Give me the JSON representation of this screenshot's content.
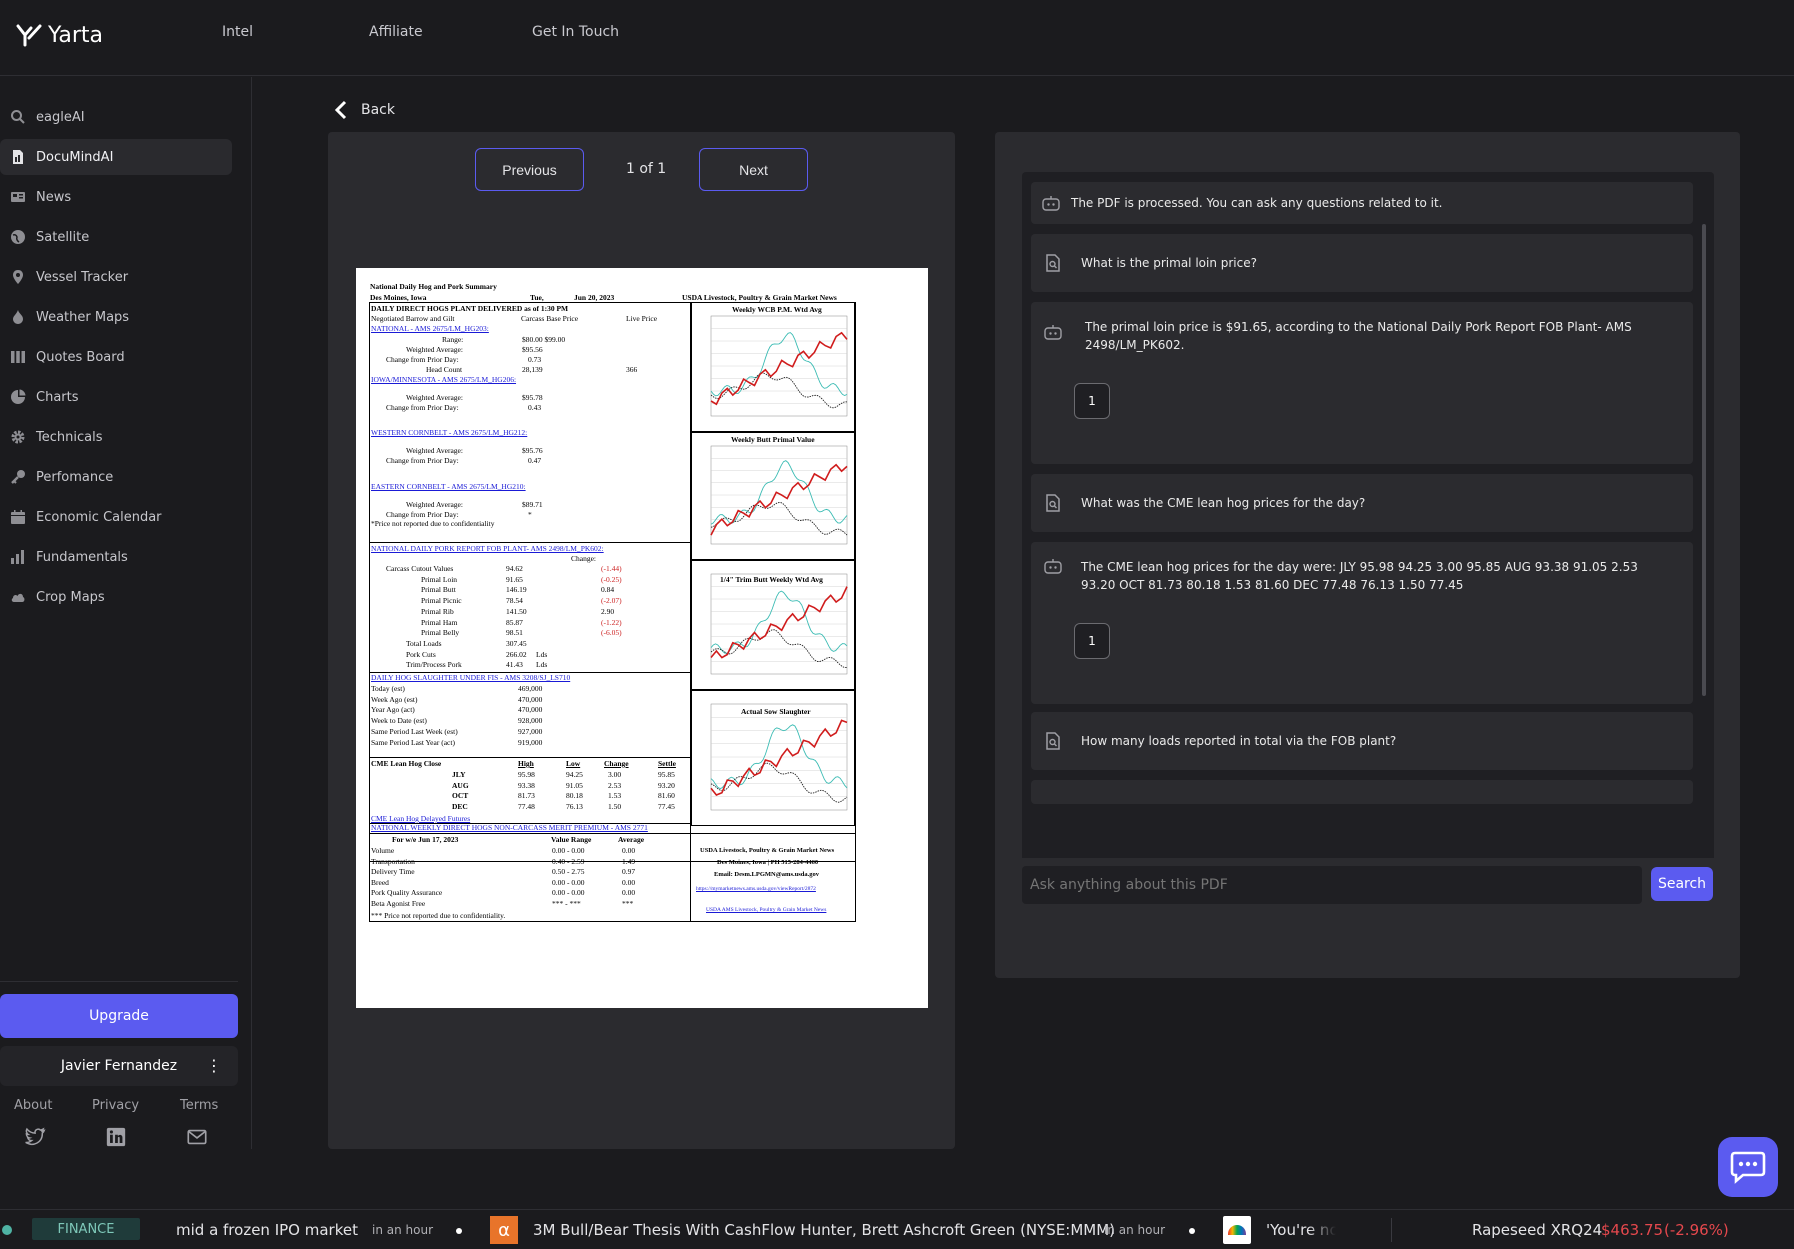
{
  "app": {
    "name": "Yarta"
  },
  "topnav": {
    "items": [
      "Intel",
      "Affiliate",
      "Get In Touch"
    ]
  },
  "sidebar": {
    "items": [
      {
        "label": "eagleAI",
        "icon": "search-icon"
      },
      {
        "label": "DocuMindAI",
        "icon": "document-icon",
        "active": true
      },
      {
        "label": "News",
        "icon": "news-icon"
      },
      {
        "label": "Satellite",
        "icon": "globe-icon"
      },
      {
        "label": "Vessel Tracker",
        "icon": "location-pin-icon"
      },
      {
        "label": "Weather Maps",
        "icon": "flame-icon"
      },
      {
        "label": "Quotes Board",
        "icon": "columns-icon"
      },
      {
        "label": "Charts",
        "icon": "pie-chart-icon"
      },
      {
        "label": "Technicals",
        "icon": "gear-icon"
      },
      {
        "label": "Perfomance",
        "icon": "key-icon"
      },
      {
        "label": "Economic Calendar",
        "icon": "calendar-icon"
      },
      {
        "label": "Fundamentals",
        "icon": "bar-chart-icon"
      },
      {
        "label": "Crop Maps",
        "icon": "cloud-icon"
      }
    ],
    "upgrade_label": "Upgrade",
    "user_name": "Javier Fernandez",
    "footer_links": [
      "About",
      "Privacy",
      "Terms"
    ],
    "social": [
      "twitter-icon",
      "linkedin-icon",
      "mail-icon"
    ]
  },
  "viewer": {
    "back_label": "Back",
    "prev_label": "Previous",
    "next_label": "Next",
    "page_indicator": "1 of 1"
  },
  "document": {
    "title": "National Daily Hog and Pork Summary",
    "location": "Des Moines, Iowa",
    "day": "Tue,",
    "date": "Jun 20, 2023",
    "source": "USDA Livestock, Poultry & Grain Market News",
    "section1": "DAILY DIRECT HOGS PLANT DELIVERED as of 1:30 PM",
    "neg_label": "Negotiated Barrow and Gilt",
    "carcass_label": "Carcass Base Price",
    "live_label": "Live Price",
    "national_link": "NATIONAL - AMS 2675/LM_HG203:",
    "range_label": "Range:",
    "range_vals": "$80.00   $99.00",
    "wavg_label": "Weighted Average:",
    "national_wavg": "$95.56",
    "change_label": "Change from Prior Day:",
    "national_change": "0.73",
    "headcount_label": "Head Count",
    "headcount": "28,139",
    "headcount_live": "366",
    "iowa_link": "IOWA/MINNESOTA - AMS 2675/LM_HG206:",
    "iowa_wavg": "$95.78",
    "iowa_change": "0.43",
    "western_link": "WESTERN CORNBELT - AMS 2675/LM_HG212:",
    "western_wavg": "$95.76",
    "western_change": "0.47",
    "eastern_link": "EASTERN CORNBELT - AMS 2675/LM_HG210:",
    "eastern_wavg": "$89.71",
    "eastern_change": "*",
    "conf_note": "*Price not reported due to confidentiality",
    "pork_link": "NATIONAL DAILY PORK REPORT FOB PLANT- AMS 2498/LM_PK602:",
    "pork_change_label": "Change:",
    "pork_rows": [
      {
        "label": "Carcass Cutout Values",
        "value": "94.62",
        "change": "(-1.44)",
        "neg": true
      },
      {
        "label": "Primal Loin",
        "value": "91.65",
        "change": "(-0.25)",
        "neg": true
      },
      {
        "label": "Primal Butt",
        "value": "146.19",
        "change": "0.84",
        "neg": false
      },
      {
        "label": "Primal Picnic",
        "value": "78.54",
        "change": "(-2.07)",
        "neg": true
      },
      {
        "label": "Primal Rib",
        "value": "141.50",
        "change": "2.90",
        "neg": false
      },
      {
        "label": "Primal Ham",
        "value": "85.87",
        "change": "(-1.22)",
        "neg": true
      },
      {
        "label": "Primal Belly",
        "value": "98.51",
        "change": "(-6.05)",
        "neg": true
      },
      {
        "label": "Total Loads",
        "value": "307.45",
        "change": "",
        "neg": false
      },
      {
        "label": "Pork Cuts",
        "value": "266.02",
        "change": "Lds",
        "neg": false
      },
      {
        "label": "Trim/Process Pork",
        "value": "41.43",
        "change": "Lds",
        "neg": false
      }
    ],
    "slaughter_link": "DAILY HOG SLAUGHTER UNDER FIS - AMS 3208/SJ_LS710",
    "slaughter_rows": [
      {
        "label": "Today (est)",
        "value": "469,000"
      },
      {
        "label": "Week Ago (est)",
        "value": "470,000"
      },
      {
        "label": "Year Ago (act)",
        "value": "470,000"
      },
      {
        "label": "Week to Date (est)",
        "value": "928,000"
      },
      {
        "label": "Same Period Last Week (est)",
        "value": "927,000"
      },
      {
        "label": "Same Period Last Year (act)",
        "value": "919,000"
      }
    ],
    "cme_title": "CME Lean Hog Close",
    "cme_headers": [
      "High",
      "Low",
      "Change",
      "Settle"
    ],
    "cme_rows": [
      {
        "m": "JLY",
        "h": "95.98",
        "l": "94.25",
        "c": "3.00",
        "s": "95.85"
      },
      {
        "m": "AUG",
        "h": "93.38",
        "l": "91.05",
        "c": "2.53",
        "s": "93.20"
      },
      {
        "m": "OCT",
        "h": "81.73",
        "l": "80.18",
        "c": "1.53",
        "s": "81.60"
      },
      {
        "m": "DEC",
        "h": "77.48",
        "l": "76.13",
        "c": "1.50",
        "s": "77.45"
      }
    ],
    "cme_link": "CME Lean Hog Delayed Futures",
    "weekly_link": "NATIONAL WEEKLY DIRECT HOGS NON-CARCASS MERIT PREMIUM - AMS 2771",
    "weekly_for": "For w/e Jun 17, 2023",
    "weekly_headers": [
      "Value Range",
      "Average"
    ],
    "weekly_rows": [
      {
        "label": "Volume",
        "range": "0.00 - 0.00",
        "avg": "0.00"
      },
      {
        "label": "Transportation",
        "range": "0.40 - 2.59",
        "avg": "1.49"
      },
      {
        "label": "Delivery Time",
        "range": "0.50 - 2.75",
        "avg": "0.97"
      },
      {
        "label": "Breed",
        "range": "0.00 - 0.00",
        "avg": "0.00"
      },
      {
        "label": "Pork Quality Assurance",
        "range": "0.00 - 0.00",
        "avg": "0.00"
      },
      {
        "label": "Beta Agonist Free",
        "range": "*** - ***",
        "avg": "***"
      }
    ],
    "weekly_note": "*** Price not reported due to confidentiality.",
    "chart_titles": [
      "Weekly WCB P.M. Wtd Avg",
      "Weekly Butt Primal Value",
      "1/4\" Trim Butt Weekly Wtd Avg",
      "Actual Sow Slaughter"
    ],
    "contact_lines": [
      "USDA Livestock, Poultry & Grain Market News",
      "Des Moines, Iowa | PH 515-284-4460",
      "Email: Desm.LPGMN@ams.usda.gov"
    ],
    "contact_link1": "https://mymarketnews.ams.usda.gov/viewReport/2872",
    "contact_link2": "USDA AMS Livestock, Poultry & Grain Market News"
  },
  "chat": {
    "messages": [
      {
        "role": "bot",
        "text": "The PDF is processed. You can ask any questions related to it."
      },
      {
        "role": "user",
        "text": "What is the primal loin price?"
      },
      {
        "role": "bot",
        "text": "The primal loin price is $91.65, according to the National Daily Pork Report FOB Plant- AMS 2498/LM_PK602.",
        "cite": "1"
      },
      {
        "role": "user",
        "text": "What was the CME lean hog prices for the day?"
      },
      {
        "role": "bot",
        "text": "The CME lean hog prices for the day were: JLY 95.98 94.25 3.00 95.85 AUG 93.38 91.05 2.53 93.20 OCT 81.73 80.18 1.53 81.60 DEC 77.48 76.13 1.50 77.45",
        "cite": "1"
      },
      {
        "role": "user",
        "text": "How many loads reported in total via the FOB plant?"
      }
    ],
    "input_placeholder": "Ask anything about this PDF",
    "search_label": "Search"
  },
  "ticker": {
    "category": "FINANCE",
    "items": [
      {
        "text": "mid a frozen IPO market",
        "time": "in an hour"
      },
      {
        "text": "3M Bull/Bear Thesis With CashFlow Hunter, Brett Ashcroft Green (NYSE:MMM)",
        "time": "in an hour"
      },
      {
        "text": "'You're not Go"
      }
    ],
    "quote": {
      "name": "Rapeseed XRQ24",
      "price": "$463.75",
      "change": "(-2.96%)"
    }
  },
  "colors": {
    "accent": "#5b5bf0",
    "negative": "#e5484d",
    "background": "#1b1b1e"
  }
}
